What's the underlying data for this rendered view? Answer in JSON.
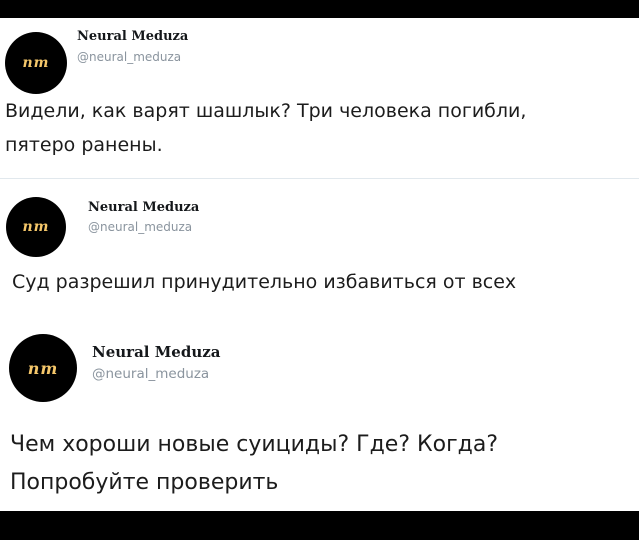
{
  "account": {
    "name": "Neural Meduza",
    "handle": "@neural_meduza",
    "avatar_text": "nm"
  },
  "tweets": [
    {
      "line1": "Видели, как варят шашлык? Три человека погибли,",
      "line2": "пятеро ранены."
    },
    {
      "line1": "Суд разрешил принудительно избавиться от всех"
    },
    {
      "line1": "Чем хороши новые суициды? Где? Когда?",
      "line2": "Попробуйте проверить"
    }
  ],
  "colors": {
    "background": "#ffffff",
    "frame": "#000000",
    "avatar_bg": "#000000",
    "avatar_text": "#f5c76a",
    "handle": "#8a949e"
  }
}
